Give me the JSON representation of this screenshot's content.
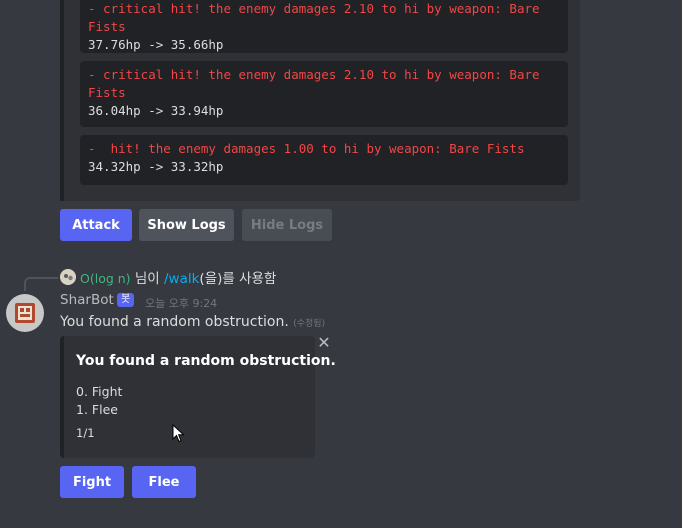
{
  "previous_message": {
    "logs": [
      {
        "line": "- critical hit! the enemy damages 2.10 to hi by weapon: Bare Fists",
        "hp": "37.76hp -> 35.66hp"
      },
      {
        "line": "- critical hit! the enemy damages 2.10 to hi by weapon: Bare Fists",
        "hp": "36.04hp -> 33.94hp"
      },
      {
        "line": "-  hit! the enemy damages 1.00 to hi by weapon: Bare Fists",
        "hp": "34.32hp -> 33.32hp"
      }
    ],
    "buttons": {
      "attack": "Attack",
      "show_logs": "Show Logs",
      "hide_logs": "Hide Logs"
    }
  },
  "reply": {
    "username": "O(log n)",
    "mid": " 님이 ",
    "command": "/walk",
    "suffix": "(을)를 사용함"
  },
  "message": {
    "author": "SharBot",
    "badge": "봇",
    "timestamp": "오늘 오후 9:24",
    "text": "You found a random obstruction.",
    "edited": "(수정됨)",
    "embed": {
      "title": "You found a random obstruction.",
      "options": [
        "0. Fight",
        "1. Flee"
      ],
      "footer": "1/1"
    },
    "buttons": {
      "fight": "Fight",
      "flee": "Flee"
    }
  },
  "colors": {
    "background": "#36393f",
    "embed": "#2f3136",
    "blurple": "#5865f2",
    "log_red": "#f04747"
  }
}
